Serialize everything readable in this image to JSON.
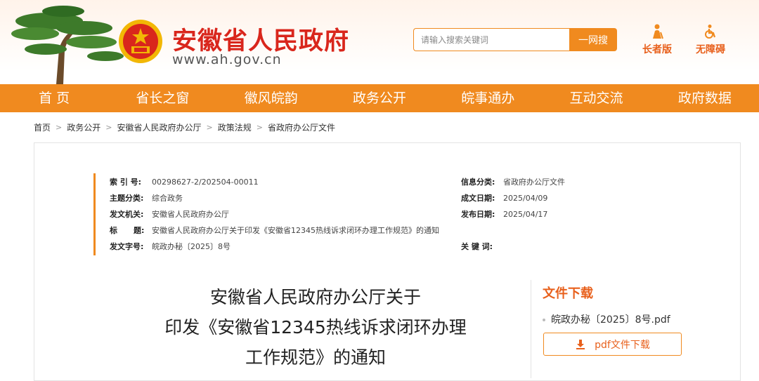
{
  "site": {
    "title": "安徽省人民政府",
    "url": "www.ah.gov.cn"
  },
  "search": {
    "placeholder": "请输入搜索关键词",
    "button": "一网搜"
  },
  "quick_links": {
    "elder": "长者版",
    "accessible": "无障碍"
  },
  "nav": [
    "首  页",
    "省长之窗",
    "徽风皖韵",
    "政务公开",
    "皖事通办",
    "互动交流",
    "政府数据"
  ],
  "breadcrumb": [
    "首页",
    "政务公开",
    "安徽省人民政府办公厅",
    "政策法规",
    "省政府办公厅文件"
  ],
  "meta": {
    "index_key": "索 引 号:",
    "index_val": "00298627-2/202504-00011",
    "topic_key": "主题分类:",
    "topic_val": "综合政务",
    "issuer_key": "发文机关:",
    "issuer_val": "安徽省人民政府办公厅",
    "title_key": "标      题:",
    "title_val": "安徽省人民政府办公厅关于印发《安徽省12345热线诉求闭环办理工作规范》的通知",
    "docno_key": "发文字号:",
    "docno_val": "皖政办秘〔2025〕8号",
    "info_key": "信息分类:",
    "info_val": "省政府办公厅文件",
    "created_key": "成文日期:",
    "created_val": "2025/04/09",
    "published_key": "发布日期:",
    "published_val": "2025/04/17",
    "keywords_key": "关 键 词:",
    "keywords_val": ""
  },
  "document": {
    "title_line1": "安徽省人民政府办公厅关于",
    "title_line2": "印发《安徽省12345热线诉求闭环办理",
    "title_line3": "工作规范》的通知"
  },
  "download": {
    "heading": "文件下载",
    "file_name": "皖政办秘〔2025〕8号.pdf",
    "button": "pdf文件下载"
  },
  "colors": {
    "brand_red": "#d9261c",
    "accent_orange": "#f08a1f"
  }
}
